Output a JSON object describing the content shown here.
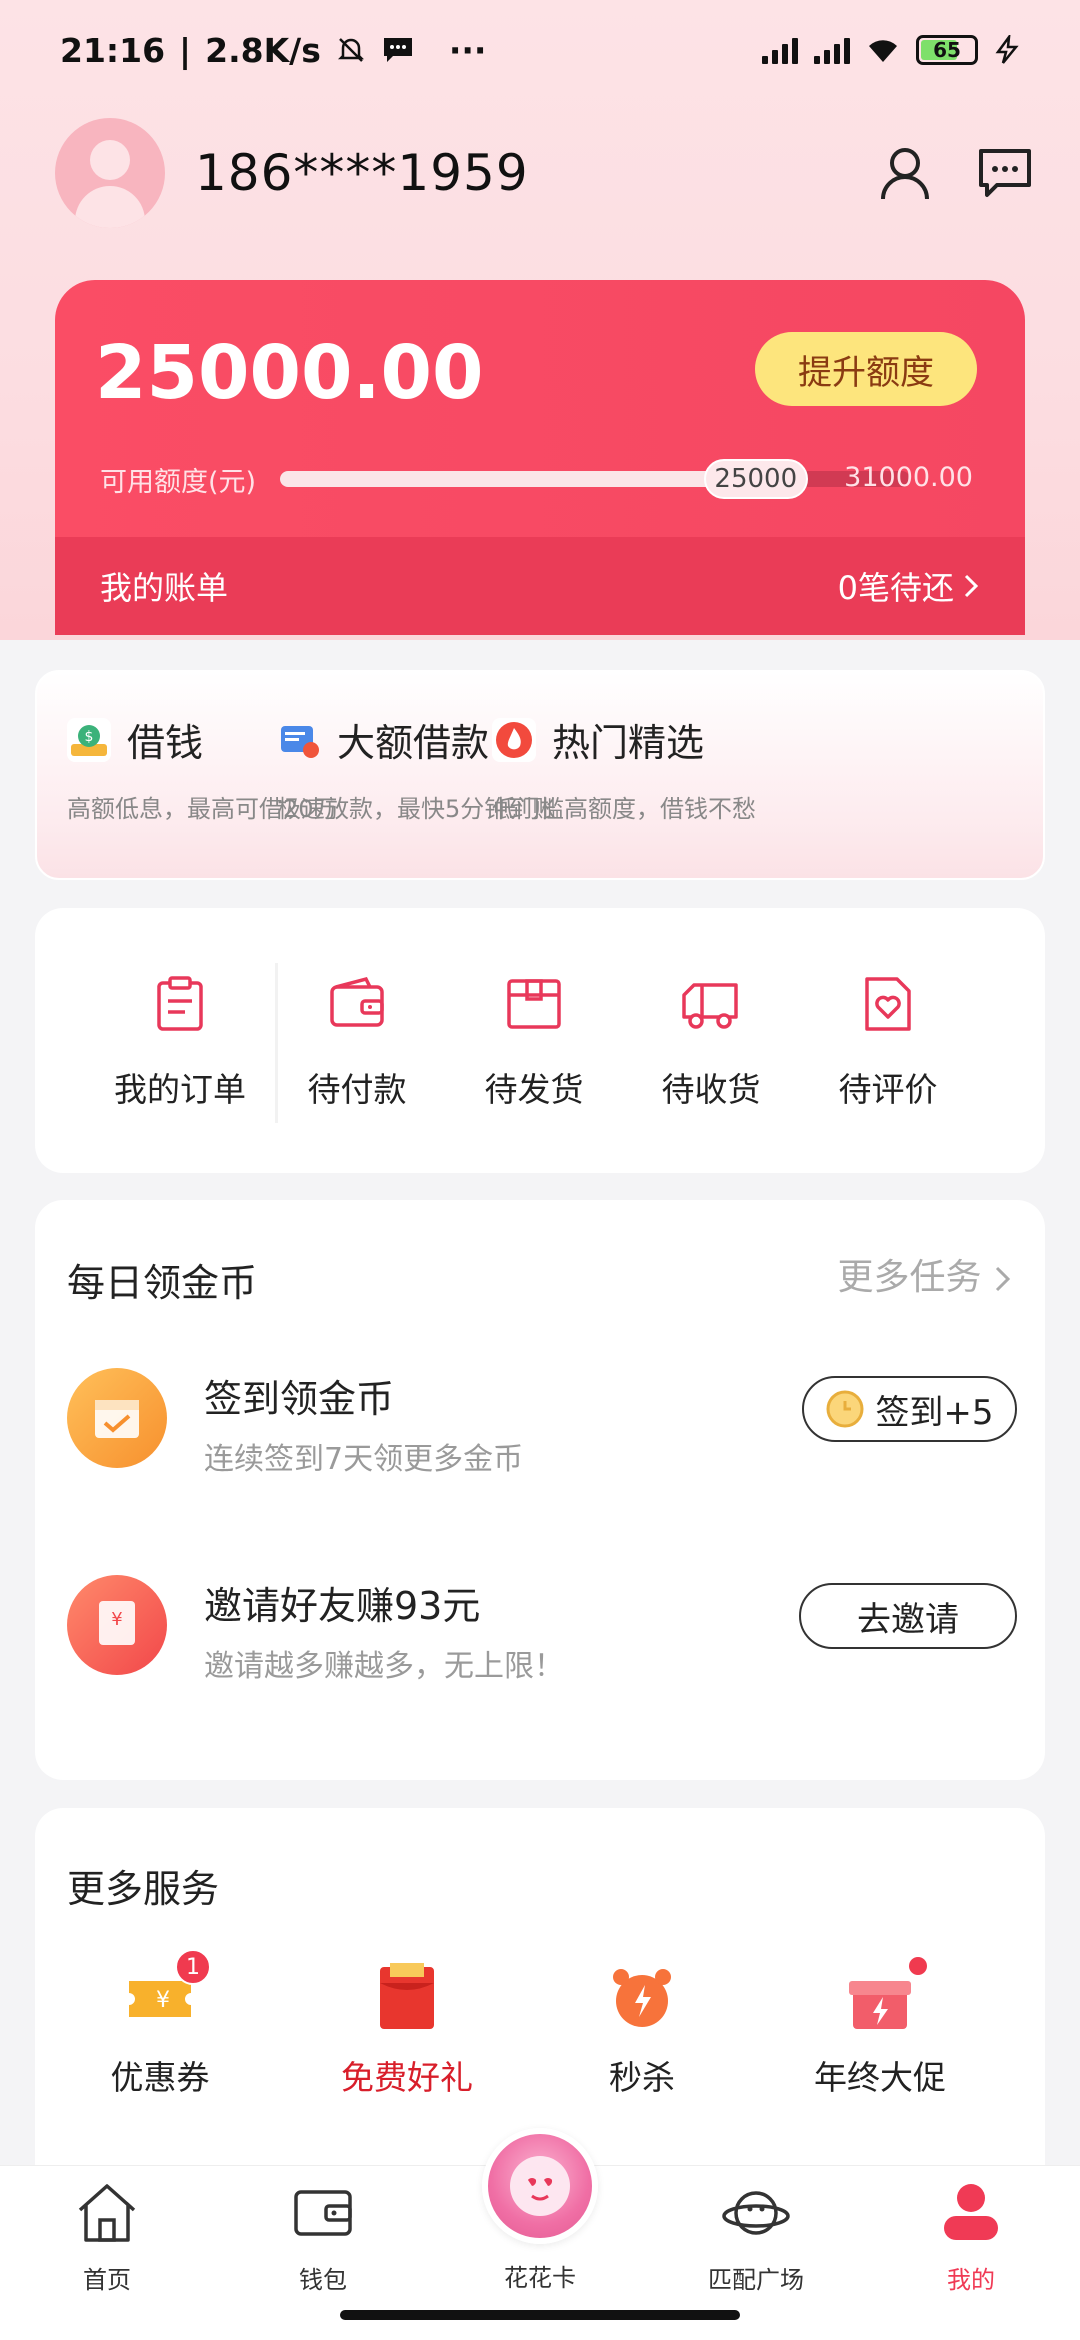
{
  "status_bar": {
    "time": "21:16",
    "speed": "2.8K/s",
    "more": "···",
    "battery": "65"
  },
  "header": {
    "phone": "186****1959"
  },
  "credit": {
    "amount": "25000.00",
    "raise_button": "提升额度",
    "available_label": "可用额度(元)",
    "current": "25000",
    "max": "31000.00",
    "used_fraction": 0.806,
    "bill_label": "我的账单",
    "bill_status": "0笔待还",
    "accent": "#fa4d65"
  },
  "loans": [
    {
      "title": "借钱",
      "subtitle": "高额低息，最高可借20万",
      "icon": "money-bag-icon"
    },
    {
      "title": "大额借款",
      "subtitle": "极速放款，最快5分钟到账",
      "icon": "card-icon"
    },
    {
      "title": "热门精选",
      "subtitle": "低门槛高额度，借钱不愁",
      "icon": "fire-icon"
    }
  ],
  "orders": [
    {
      "label": "我的订单",
      "icon": "clipboard-icon"
    },
    {
      "label": "待付款",
      "icon": "wallet-icon"
    },
    {
      "label": "待发货",
      "icon": "box-icon"
    },
    {
      "label": "待收货",
      "icon": "truck-icon"
    },
    {
      "label": "待评价",
      "icon": "heart-doc-icon"
    }
  ],
  "daily": {
    "title": "每日领金币",
    "more": "更多任务",
    "tasks": [
      {
        "title": "签到领金币",
        "subtitle": "连续签到7天领更多金币",
        "button": "签到+5",
        "icon": "calendar-icon"
      },
      {
        "title": "邀请好友赚93元",
        "subtitle": "邀请越多赚越多，无上限！",
        "button": "去邀请",
        "icon": "red-envelope-icon"
      }
    ]
  },
  "services": {
    "title": "更多服务",
    "items": [
      {
        "label": "优惠券",
        "badge": "1",
        "icon": "coupon-icon"
      },
      {
        "label": "免费好礼",
        "icon": "gift-envelope-icon"
      },
      {
        "label": "秒杀",
        "icon": "alarm-clock-icon"
      },
      {
        "label": "年终大促",
        "icon": "gift-box-icon"
      }
    ]
  },
  "nav": [
    {
      "label": "首页",
      "icon": "home-icon"
    },
    {
      "label": "钱包",
      "icon": "wallet-icon"
    },
    {
      "label": "花花卡",
      "icon": "flower-card-icon"
    },
    {
      "label": "匹配广场",
      "icon": "planet-icon"
    },
    {
      "label": "我的",
      "icon": "profile-icon",
      "active": true
    }
  ]
}
